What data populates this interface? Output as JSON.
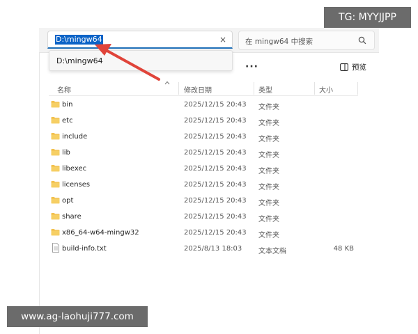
{
  "address_bar": {
    "value": "D:\\mingw64",
    "clear_glyph": "×"
  },
  "search": {
    "placeholder": "在 mingw64 中搜索",
    "icon": "search-icon"
  },
  "autocomplete": {
    "items": [
      {
        "label": "D:\\mingw64"
      }
    ]
  },
  "toolbar": {
    "more_label": "···",
    "preview_label": "预览",
    "preview_icon": "preview-pane-icon"
  },
  "columns": {
    "name": "名称",
    "modified": "修改日期",
    "type": "类型",
    "size": "大小"
  },
  "files": [
    {
      "name": "bin",
      "modified": "2025/12/15 20:43",
      "type": "文件夹",
      "size": "",
      "icon": "folder-icon"
    },
    {
      "name": "etc",
      "modified": "2025/12/15 20:43",
      "type": "文件夹",
      "size": "",
      "icon": "folder-icon"
    },
    {
      "name": "include",
      "modified": "2025/12/15 20:43",
      "type": "文件夹",
      "size": "",
      "icon": "folder-icon"
    },
    {
      "name": "lib",
      "modified": "2025/12/15 20:43",
      "type": "文件夹",
      "size": "",
      "icon": "folder-icon"
    },
    {
      "name": "libexec",
      "modified": "2025/12/15 20:43",
      "type": "文件夹",
      "size": "",
      "icon": "folder-icon"
    },
    {
      "name": "licenses",
      "modified": "2025/12/15 20:43",
      "type": "文件夹",
      "size": "",
      "icon": "folder-icon"
    },
    {
      "name": "opt",
      "modified": "2025/12/15 20:43",
      "type": "文件夹",
      "size": "",
      "icon": "folder-icon"
    },
    {
      "name": "share",
      "modified": "2025/12/15 20:43",
      "type": "文件夹",
      "size": "",
      "icon": "folder-icon"
    },
    {
      "name": "x86_64-w64-mingw32",
      "modified": "2025/12/15 20:43",
      "type": "文件夹",
      "size": "",
      "icon": "folder-icon"
    },
    {
      "name": "build-info.txt",
      "modified": "2025/8/13 18:03",
      "type": "文本文档",
      "size": "48 KB",
      "icon": "text-file-icon"
    }
  ],
  "watermarks": {
    "top": "TG: MYYJJPP",
    "bottom": "www.ag-laohuji777.com"
  },
  "colors": {
    "selection": "#0b63c7",
    "folder": "#f2c14e",
    "arrow": "#e0443a",
    "watermark_bg": "#6b6b6b"
  }
}
